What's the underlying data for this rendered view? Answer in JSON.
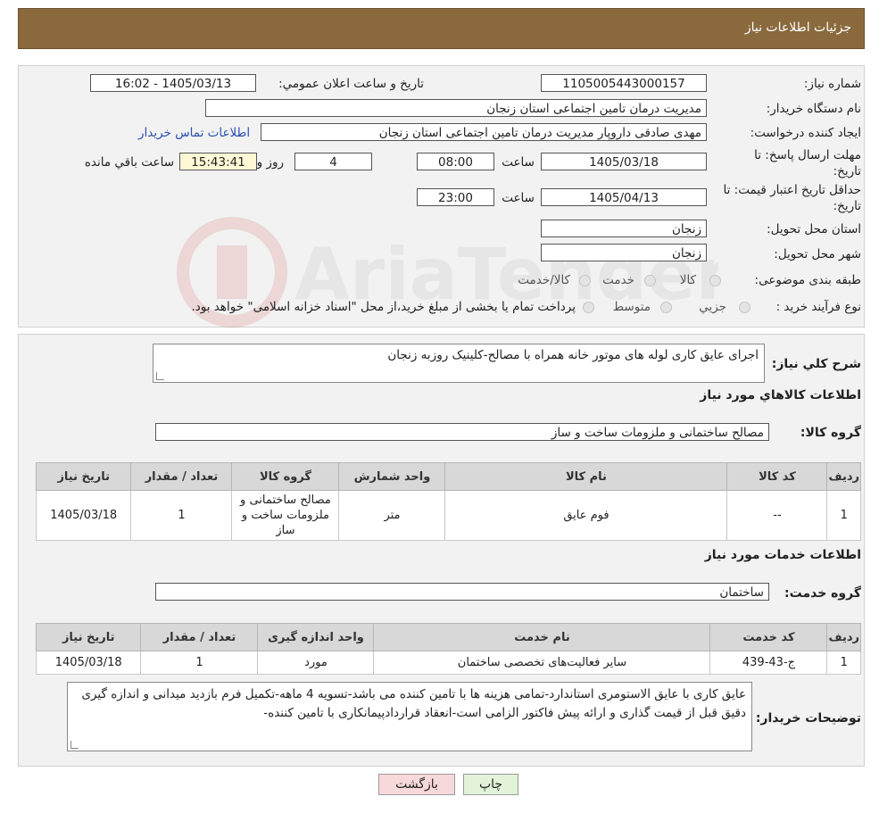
{
  "header": {
    "title": "جزئیات اطلاعات نیاز"
  },
  "info": {
    "need_number_label": "شماره نیاز:",
    "need_number": "1105005443000157",
    "announce_label": "تاريخ و ساعت اعلان عمومي:",
    "announce_value": "1405/03/13 - 16:02",
    "buyer_org_label": "نام دستگاه خريدار:",
    "buyer_org": "مديريت درمان تامين اجتماعی استان زنجان",
    "creator_label": "ايجاد کننده درخواست:",
    "creator": "مهدی صادقی داروپار مديريت درمان تامين اجتماعی استان زنجان",
    "contact_link": "اطلاعات تماس خريدار",
    "deadline_label_1": "مهلت ارسال پاسخ: تا",
    "deadline_label_2": "تاريخ:",
    "deadline_date": "1405/03/18",
    "time_label": "ساعت",
    "deadline_time": "08:00",
    "days_value": "4",
    "days_label": "روز و",
    "remaining_time": "15:43:41",
    "remaining_label": "ساعت باقي مانده",
    "validity_label_1": "حداقل تاريخ اعتبار قيمت: تا",
    "validity_label_2": "تاريخ:",
    "validity_date": "1405/04/13",
    "validity_time": "23:00",
    "province_label": "استان محل تحويل:",
    "province": "زنجان",
    "city_label": "شهر محل تحويل:",
    "city": "زنجان",
    "category_label": "طبقه بندی موضوعی:",
    "category_options": [
      "کالا",
      "خدمت",
      "کالا/خدمت"
    ],
    "process_label": "نوع فرآيند خريد :",
    "process_options": [
      "جزيي",
      "متوسط"
    ],
    "process_note": "پرداخت تمام يا بخشی از مبلغ خريد،از محل \"اسناد خزانه اسلامی\" خواهد بود."
  },
  "description": {
    "label": "شرح کلي نياز:",
    "text": "اجرای عايق کاری لوله های موتور خانه همراه با مصالح-کلينيک روزبه زنجان"
  },
  "goods": {
    "section_title": "اطلاعات کالاهاي مورد نياز",
    "group_label": "گروه کالا:",
    "group_value": "مصالح ساختمانی و ملزومات ساخت و ساز",
    "columns": [
      "رديف",
      "کد کالا",
      "نام کالا",
      "واحد شمارش",
      "گروه کالا",
      "تعداد / مقدار",
      "تاريخ نياز"
    ],
    "rows": [
      [
        "1",
        "--",
        "فوم عایق",
        "متر",
        "مصالح ساختمانی و ملزومات ساخت و ساز",
        "1",
        "1405/03/18"
      ]
    ]
  },
  "services": {
    "section_title": "اطلاعات خدمات مورد نياز",
    "group_label": "گروه خدمت:",
    "group_value": "ساختمان",
    "columns": [
      "رديف",
      "کد خدمت",
      "نام خدمت",
      "واحد اندازه گيری",
      "تعداد / مقدار",
      "تاريخ نياز"
    ],
    "rows": [
      [
        "1",
        "ج-43-439",
        "ساير فعاليت‌های تخصصی ساختمان",
        "مورد",
        "1",
        "1405/03/18"
      ]
    ]
  },
  "buyer_notes": {
    "label": "توضيحات خريدار:",
    "text": "عایق کاری با عایق الاستومری استاندارد-تمامی هزینه ها با تامین کننده می باشد-تسویه 4 ماهه-تکمیل فرم بازدید میدانی و اندازه گیری دقیق قبل از قیمت گذاری و ارائه پیش فاکتور الزامی است-انعقاد قراردادپیمانکاری با تامین کننده-"
  },
  "buttons": {
    "print": "چاپ",
    "back": "بازگشت"
  },
  "colors": {
    "header_bg": "#8a6a3d",
    "link": "#2a4fb0",
    "back_btn": "#f8d9d9",
    "print_btn": "#e2f3da"
  }
}
